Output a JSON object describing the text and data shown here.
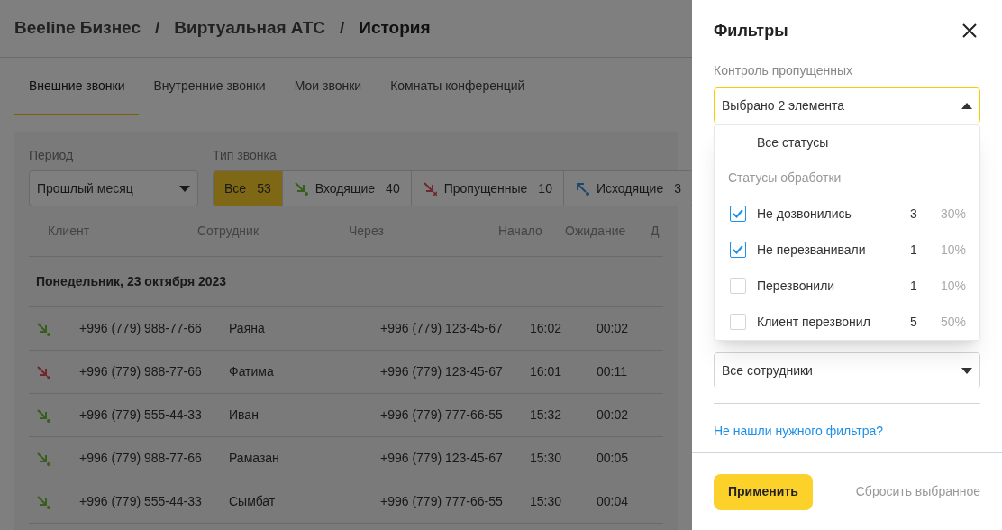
{
  "breadcrumbs": [
    "Beeline Бизнес",
    "/",
    "Виртуальная АТС",
    "/",
    "История"
  ],
  "tabs": [
    {
      "label": "Внешние звонки",
      "selected": true
    },
    {
      "label": "Внутренние звонки",
      "selected": false
    },
    {
      "label": "Мои звонки",
      "selected": false
    },
    {
      "label": "Комнаты конференций",
      "selected": false
    }
  ],
  "period": {
    "label": "Период",
    "value": "Прошлый месяц"
  },
  "call_type": {
    "label": "Тип звонка",
    "options": [
      {
        "kind": "all",
        "label": "Все",
        "count": "53",
        "selected": true
      },
      {
        "kind": "incoming",
        "label": "Входящие",
        "count": "40",
        "selected": false
      },
      {
        "kind": "missed",
        "label": "Пропущенные",
        "count": "10",
        "selected": false
      },
      {
        "kind": "outgoing",
        "label": "Исходящие",
        "count": "3",
        "selected": false
      }
    ]
  },
  "table": {
    "columns": [
      "Клиент",
      "Сотрудник",
      "Через",
      "Начало",
      "Ожидание",
      "Д"
    ],
    "group": "Понедельник, 23 октября 2023",
    "rows": [
      {
        "kind": "incoming",
        "client": "+996 (779) 988-77-66",
        "employee": "Раяна",
        "via": "+996 (779) 123-45-67",
        "start": "16:02",
        "wait": "00:02"
      },
      {
        "kind": "missed",
        "client": "+996 (779) 988-77-66",
        "employee": "Фатима",
        "via": "+996 (779) 123-45-67",
        "start": "16:01",
        "wait": "00:11"
      },
      {
        "kind": "incoming",
        "client": "+996 (779) 555-44-33",
        "employee": "Иван",
        "via": "+996 (779) 777-66-55",
        "start": "15:32",
        "wait": "00:02"
      },
      {
        "kind": "incoming",
        "client": "+996 (779) 988-77-66",
        "employee": "Рамазан",
        "via": "+996 (779) 123-45-67",
        "start": "15:30",
        "wait": "00:05"
      },
      {
        "kind": "incoming",
        "client": "+996 (779) 555-44-33",
        "employee": "Сымбат",
        "via": "+996 (779) 777-66-55",
        "start": "15:30",
        "wait": "00:04"
      }
    ]
  },
  "filters": {
    "title": "Фильтры",
    "missed_control": {
      "label": "Контроль пропущенных",
      "value": "Выбрано 2 элемента",
      "expanded": true,
      "all_option": "Все статусы",
      "group": "Статусы обработки",
      "options": [
        {
          "label": "Не дозвонились",
          "count": "3",
          "percent": "30%",
          "checked": true
        },
        {
          "label": "Не перезванивали",
          "count": "1",
          "percent": "10%",
          "checked": true
        },
        {
          "label": "Перезвонили",
          "count": "1",
          "percent": "10%",
          "checked": false
        },
        {
          "label": "Клиент перезвонил",
          "count": "5",
          "percent": "50%",
          "checked": false
        }
      ]
    },
    "participants": {
      "value": "Все сотрудники",
      "expanded": false
    },
    "link": "Не нашли нужного фильтра?",
    "apply": "Применить",
    "reset": "Сбросить выбранное"
  }
}
